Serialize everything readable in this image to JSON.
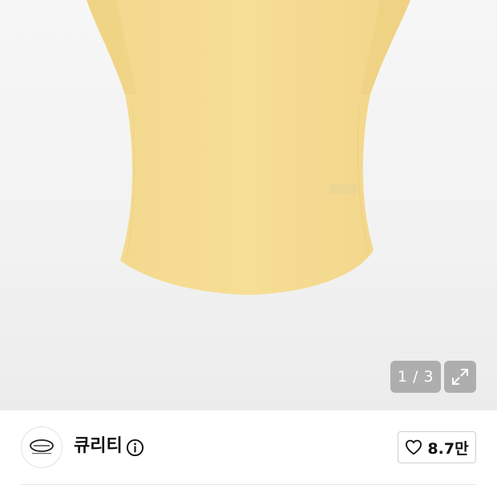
{
  "gallery": {
    "current_page": "1",
    "separator": " / ",
    "total_pages": "3",
    "image_label": "yellow-short-sleeve-top",
    "expand_icon": "expand-icon"
  },
  "seller": {
    "name": "큐리티",
    "avatar_icon": "brand-logo-icon",
    "info_icon": "info-icon"
  },
  "like": {
    "icon": "heart-icon",
    "count": "8.7만"
  },
  "colors": {
    "garment": "#f6dc8f",
    "indicator_bg": "#969696",
    "text": "#111111"
  }
}
